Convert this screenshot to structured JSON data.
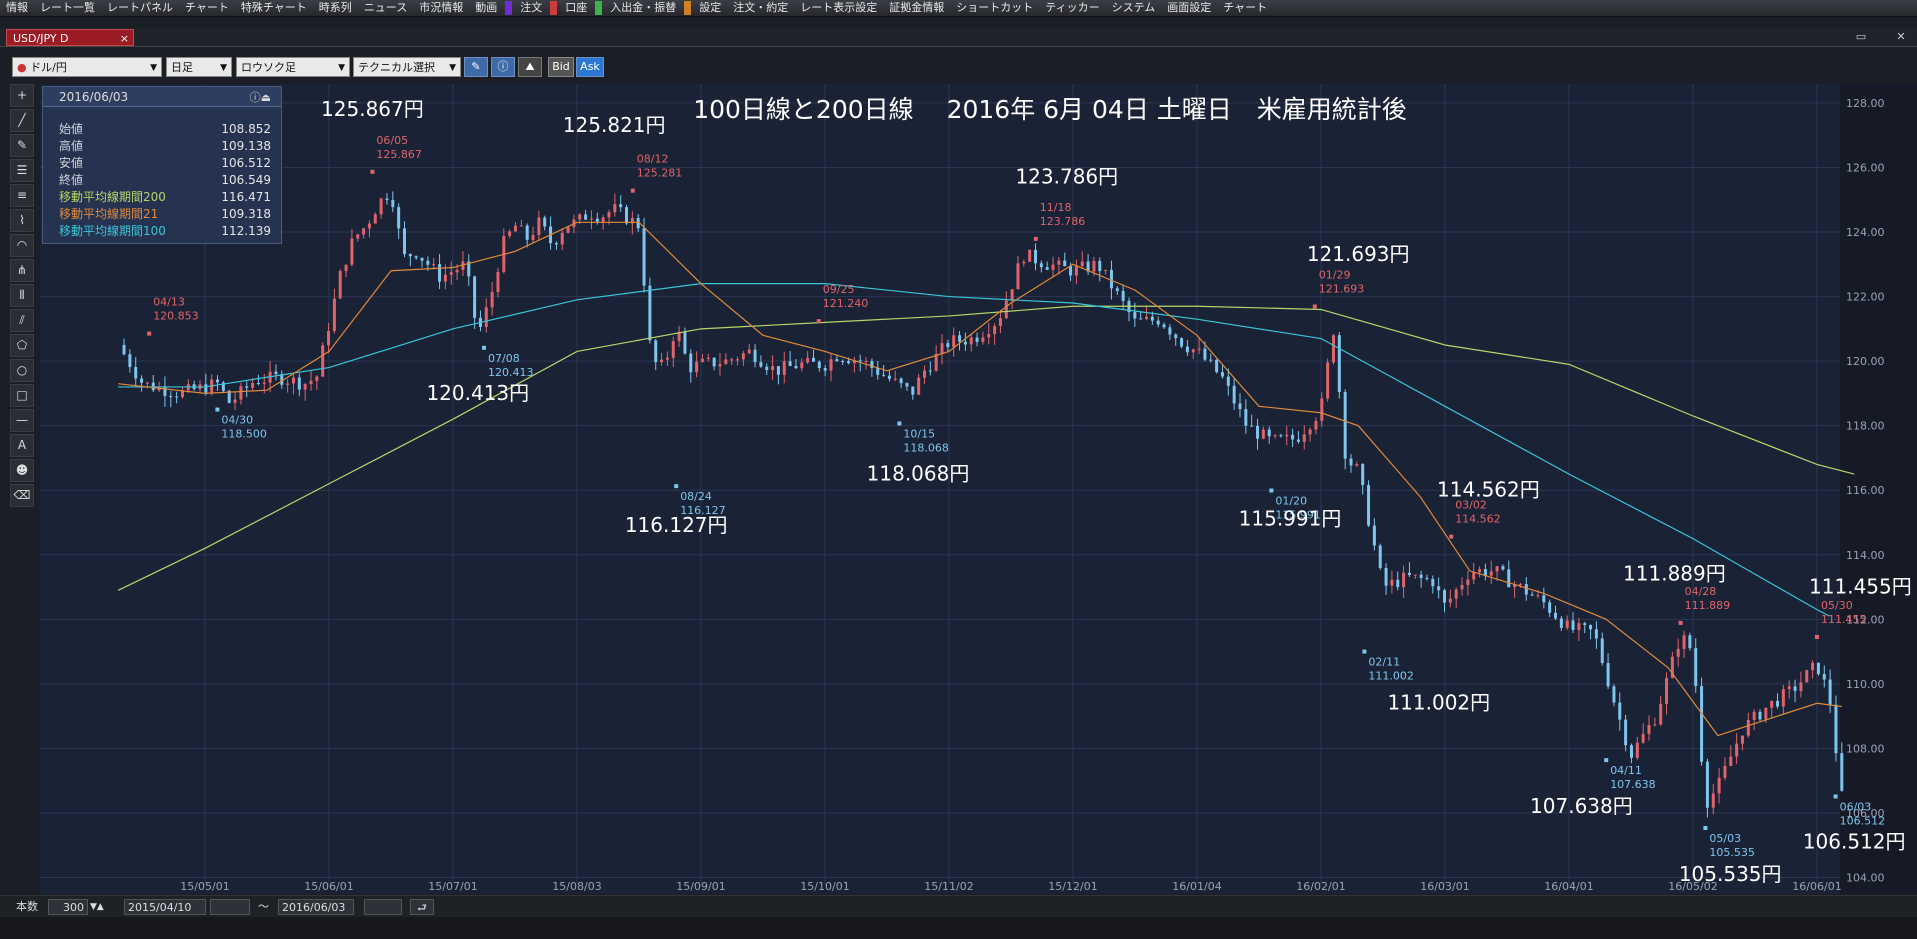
{
  "menu": [
    "情報",
    "レート一覧",
    "レートパネル",
    "チャート",
    "特殊チャート",
    "時系列",
    "ニュース",
    "市況情報",
    "動画",
    "注文",
    "口座",
    "入出金・振替",
    "設定",
    "注文・約定",
    "レート表示設定",
    "証拠金情報",
    "ショートカット",
    "ティッカー",
    "システム",
    "画面設定",
    "チャート"
  ],
  "window": {
    "tab_label": "USD/JPY D",
    "close_glyph": "×"
  },
  "toolbar": {
    "pair": "ドル/円",
    "period": "日足",
    "chart_type": "ロウソク足",
    "technical": "テクニカル選択",
    "bid_label": "Bid",
    "ask_label": "Ask"
  },
  "tools": [
    "crosshair",
    "line",
    "ruler",
    "hlines",
    "channel",
    "fan",
    "arc",
    "pitchfork",
    "cycle",
    "gann",
    "pentagon",
    "circle",
    "rect",
    "hline",
    "text",
    "icon",
    "eraser"
  ],
  "info": {
    "date": "2016/06/03",
    "rows": [
      {
        "label": "始値",
        "value": "108.852",
        "color": "#cfd3da"
      },
      {
        "label": "高値",
        "value": "109.138",
        "color": "#cfd3da"
      },
      {
        "label": "安値",
        "value": "106.512",
        "color": "#cfd3da"
      },
      {
        "label": "終値",
        "value": "106.549",
        "color": "#cfd3da"
      },
      {
        "label": "移動平均線期間200",
        "value": "116.471",
        "color": "#b7d66a"
      },
      {
        "label": "移動平均線期間21",
        "value": "109.318",
        "color": "#e08a3a"
      },
      {
        "label": "移動平均線期間100",
        "value": "112.139",
        "color": "#3ac6d6"
      }
    ]
  },
  "status": {
    "count_label": "本数",
    "count": "300",
    "from": "2015/04/10",
    "tilde": "～",
    "to": "2016/06/03"
  },
  "chart_data": {
    "type": "candlestick",
    "title": "100日線と200日線　 2016年 6月 04日 土曜日　米雇用統計後",
    "ylim": [
      103.8,
      128.4
    ],
    "yticks": [
      "104.00",
      "106.00",
      "108.00",
      "110.00",
      "112.00",
      "114.00",
      "116.00",
      "118.00",
      "120.00",
      "122.00",
      "124.00",
      "126.00",
      "128.00"
    ],
    "xticks": [
      {
        "x": 0.0,
        "label": "15/05/01"
      },
      {
        "x": 1.0,
        "label": "15/06/01"
      },
      {
        "x": 2.0,
        "label": "15/07/01"
      },
      {
        "x": 3.0,
        "label": "15/08/03"
      },
      {
        "x": 4.0,
        "label": "15/09/01"
      },
      {
        "x": 5.0,
        "label": "15/10/01"
      },
      {
        "x": 6.0,
        "label": "15/11/02"
      },
      {
        "x": 7.0,
        "label": "15/12/01"
      },
      {
        "x": 8.0,
        "label": "16/01/04"
      },
      {
        "x": 9.0,
        "label": "16/02/01"
      },
      {
        "x": 10.0,
        "label": "16/03/01"
      },
      {
        "x": 11.0,
        "label": "16/04/01"
      },
      {
        "x": 12.0,
        "label": "16/05/02"
      },
      {
        "x": 13.0,
        "label": "16/06/01"
      }
    ],
    "close_path": [
      [
        -0.7,
        120.5
      ],
      [
        -0.5,
        119.3
      ],
      [
        -0.2,
        119.0
      ],
      [
        0.1,
        119.3
      ],
      [
        0.2,
        118.7
      ],
      [
        0.4,
        119.4
      ],
      [
        0.6,
        119.5
      ],
      [
        0.8,
        119.3
      ],
      [
        0.9,
        119.5
      ],
      [
        1.1,
        122.8
      ],
      [
        1.2,
        123.8
      ],
      [
        1.3,
        124.2
      ],
      [
        1.4,
        124.9
      ],
      [
        1.5,
        125.3
      ],
      [
        1.6,
        123.2
      ],
      [
        1.7,
        123.4
      ],
      [
        1.8,
        123.0
      ],
      [
        1.9,
        122.6
      ],
      [
        2.1,
        123.0
      ],
      [
        2.2,
        120.8
      ],
      [
        2.3,
        121.9
      ],
      [
        2.4,
        123.6
      ],
      [
        2.5,
        124.2
      ],
      [
        2.6,
        123.8
      ],
      [
        2.7,
        124.3
      ],
      [
        2.8,
        123.6
      ],
      [
        2.9,
        124.2
      ],
      [
        3.0,
        124.3
      ],
      [
        3.1,
        124.6
      ],
      [
        3.2,
        124.5
      ],
      [
        3.3,
        124.7
      ],
      [
        3.5,
        124.2
      ],
      [
        3.6,
        120.0
      ],
      [
        3.7,
        119.8
      ],
      [
        3.8,
        121.1
      ],
      [
        3.9,
        119.8
      ],
      [
        4.0,
        119.9
      ],
      [
        4.2,
        120.0
      ],
      [
        4.4,
        120.3
      ],
      [
        4.6,
        119.7
      ],
      [
        4.8,
        119.9
      ],
      [
        5.0,
        119.9
      ],
      [
        5.1,
        120.2
      ],
      [
        5.3,
        120.0
      ],
      [
        5.5,
        119.5
      ],
      [
        5.7,
        119.0
      ],
      [
        5.8,
        119.7
      ],
      [
        6.0,
        120.6
      ],
      [
        6.2,
        120.7
      ],
      [
        6.4,
        121.3
      ],
      [
        6.6,
        123.3
      ],
      [
        6.8,
        123.0
      ],
      [
        7.0,
        122.8
      ],
      [
        7.2,
        123.0
      ],
      [
        7.3,
        122.4
      ],
      [
        7.5,
        121.2
      ],
      [
        7.7,
        121.3
      ],
      [
        7.9,
        120.5
      ],
      [
        8.0,
        120.3
      ],
      [
        8.2,
        119.5
      ],
      [
        8.4,
        118.0
      ],
      [
        8.6,
        117.5
      ],
      [
        8.8,
        117.6
      ],
      [
        9.0,
        118.5
      ],
      [
        9.1,
        121.0
      ],
      [
        9.2,
        117.0
      ],
      [
        9.3,
        116.6
      ],
      [
        9.5,
        113.0
      ],
      [
        9.7,
        113.3
      ],
      [
        9.9,
        113.2
      ],
      [
        10.0,
        112.4
      ],
      [
        10.2,
        113.5
      ],
      [
        10.4,
        113.5
      ],
      [
        10.6,
        113.0
      ],
      [
        10.8,
        112.5
      ],
      [
        11.0,
        111.7
      ],
      [
        11.2,
        111.6
      ],
      [
        11.4,
        109.0
      ],
      [
        11.5,
        107.8
      ],
      [
        11.7,
        109.0
      ],
      [
        11.9,
        111.5
      ],
      [
        12.0,
        111.0
      ],
      [
        12.1,
        106.3
      ],
      [
        12.2,
        106.8
      ],
      [
        12.4,
        108.6
      ],
      [
        12.6,
        109.3
      ],
      [
        12.8,
        109.8
      ],
      [
        13.0,
        110.6
      ],
      [
        13.1,
        109.6
      ],
      [
        13.2,
        106.5
      ]
    ],
    "series": [
      {
        "name": "移動平均線期間200",
        "color": "#b7d66a",
        "points": [
          [
            -0.7,
            112.9
          ],
          [
            0,
            114.2
          ],
          [
            1,
            116.2
          ],
          [
            2,
            118.2
          ],
          [
            3,
            120.3
          ],
          [
            4,
            121.0
          ],
          [
            5,
            121.2
          ],
          [
            6,
            121.4
          ],
          [
            7,
            121.7
          ],
          [
            8,
            121.7
          ],
          [
            9,
            121.6
          ],
          [
            10,
            120.5
          ],
          [
            11,
            119.9
          ],
          [
            12,
            118.3
          ],
          [
            13,
            116.8
          ],
          [
            13.3,
            116.5
          ]
        ]
      },
      {
        "name": "移動平均線期間100",
        "color": "#3ac6d6",
        "points": [
          [
            -0.7,
            119.2
          ],
          [
            0,
            119.2
          ],
          [
            1,
            119.8
          ],
          [
            2,
            121.0
          ],
          [
            3,
            121.9
          ],
          [
            4,
            122.4
          ],
          [
            5,
            122.4
          ],
          [
            6,
            122.0
          ],
          [
            7,
            121.8
          ],
          [
            8,
            121.3
          ],
          [
            9,
            120.7
          ],
          [
            10,
            118.6
          ],
          [
            11,
            116.5
          ],
          [
            12,
            114.5
          ],
          [
            13,
            112.3
          ],
          [
            13.1,
            112.1
          ]
        ]
      },
      {
        "name": "移動平均線期間21",
        "color": "#e08a3a",
        "points": [
          [
            -0.7,
            119.3
          ],
          [
            0,
            119.0
          ],
          [
            0.5,
            119.1
          ],
          [
            1,
            120.3
          ],
          [
            1.5,
            122.8
          ],
          [
            2,
            122.9
          ],
          [
            2.5,
            123.4
          ],
          [
            3,
            124.3
          ],
          [
            3.5,
            124.3
          ],
          [
            4,
            122.4
          ],
          [
            4.5,
            120.8
          ],
          [
            5,
            120.3
          ],
          [
            5.5,
            119.7
          ],
          [
            6,
            120.3
          ],
          [
            6.5,
            121.8
          ],
          [
            7,
            123.0
          ],
          [
            7.5,
            122.2
          ],
          [
            8,
            120.8
          ],
          [
            8.5,
            118.6
          ],
          [
            9,
            118.4
          ],
          [
            9.3,
            118.0
          ],
          [
            9.8,
            115.8
          ],
          [
            10.2,
            113.5
          ],
          [
            10.8,
            112.8
          ],
          [
            11.3,
            112.0
          ],
          [
            11.8,
            110.5
          ],
          [
            12.2,
            108.4
          ],
          [
            12.6,
            108.9
          ],
          [
            13.0,
            109.4
          ],
          [
            13.2,
            109.3
          ]
        ]
      }
    ],
    "markers": [
      {
        "x": -0.45,
        "y": 120.853,
        "date": "04/13",
        "value": "120.853",
        "kind": "high"
      },
      {
        "x": 0.1,
        "y": 118.5,
        "date": "04/30",
        "value": "118.500",
        "kind": "low"
      },
      {
        "x": 1.35,
        "y": 125.867,
        "date": "06/05",
        "value": "125.867",
        "kind": "high"
      },
      {
        "x": 2.25,
        "y": 120.413,
        "date": "07/08",
        "value": "120.413",
        "kind": "low"
      },
      {
        "x": 3.45,
        "y": 125.281,
        "date": "08/12",
        "value": "125.281",
        "kind": "high"
      },
      {
        "x": 3.8,
        "y": 116.127,
        "date": "08/24",
        "value": "116.127",
        "kind": "low"
      },
      {
        "x": 4.95,
        "y": 121.24,
        "date": "09/25",
        "value": "121.240",
        "kind": "high"
      },
      {
        "x": 5.6,
        "y": 118.068,
        "date": "10/15",
        "value": "118.068",
        "kind": "low"
      },
      {
        "x": 6.7,
        "y": 123.786,
        "date": "11/18",
        "value": "123.786",
        "kind": "high"
      },
      {
        "x": 8.6,
        "y": 115.991,
        "date": "01/20",
        "value": "115.991",
        "kind": "low"
      },
      {
        "x": 8.95,
        "y": 121.693,
        "date": "01/29",
        "value": "121.693",
        "kind": "high"
      },
      {
        "x": 9.35,
        "y": 111.002,
        "date": "02/11",
        "value": "111.002",
        "kind": "low"
      },
      {
        "x": 10.05,
        "y": 114.562,
        "date": "03/02",
        "value": "114.562",
        "kind": "high"
      },
      {
        "x": 11.3,
        "y": 107.638,
        "date": "04/11",
        "value": "107.638",
        "kind": "low"
      },
      {
        "x": 11.9,
        "y": 111.889,
        "date": "04/28",
        "value": "111.889",
        "kind": "high"
      },
      {
        "x": 12.1,
        "y": 105.535,
        "date": "05/03",
        "value": "105.535",
        "kind": "low"
      },
      {
        "x": 13.0,
        "y": 111.455,
        "date": "05/30",
        "value": "111.455",
        "kind": "high"
      },
      {
        "x": 13.15,
        "y": 106.512,
        "date": "06/03",
        "value": "106.512",
        "kind": "low"
      }
    ],
    "annotations": [
      {
        "text": "125.867円",
        "x": 1.35,
        "y": 127.6
      },
      {
        "text": "125.821円",
        "x": 3.3,
        "y": 127.1
      },
      {
        "text": "120.413円",
        "x": 2.2,
        "y": 118.8
      },
      {
        "text": "116.127円",
        "x": 3.8,
        "y": 114.7
      },
      {
        "text": "118.068円",
        "x": 5.75,
        "y": 116.3
      },
      {
        "text": "123.786円",
        "x": 6.95,
        "y": 125.5
      },
      {
        "text": "121.693円",
        "x": 9.3,
        "y": 123.1
      },
      {
        "text": "115.991円",
        "x": 8.75,
        "y": 114.9
      },
      {
        "text": "114.562円",
        "x": 10.35,
        "y": 115.8
      },
      {
        "text": "111.002円",
        "x": 9.95,
        "y": 109.2
      },
      {
        "text": "111.889円",
        "x": 11.85,
        "y": 113.2
      },
      {
        "text": "107.638円",
        "x": 11.1,
        "y": 106.0
      },
      {
        "text": "105.535円",
        "x": 12.3,
        "y": 103.9
      },
      {
        "text": "111.455円",
        "x": 13.35,
        "y": 112.8
      },
      {
        "text": "106.512円",
        "x": 13.3,
        "y": 104.9
      }
    ],
    "colors": {
      "up": "#e0646a",
      "down": "#7fc6ef",
      "bg": "#1a2236",
      "grid": "#2b3752",
      "high_marker": "#e0646a",
      "low_marker": "#7fc6ef"
    }
  }
}
